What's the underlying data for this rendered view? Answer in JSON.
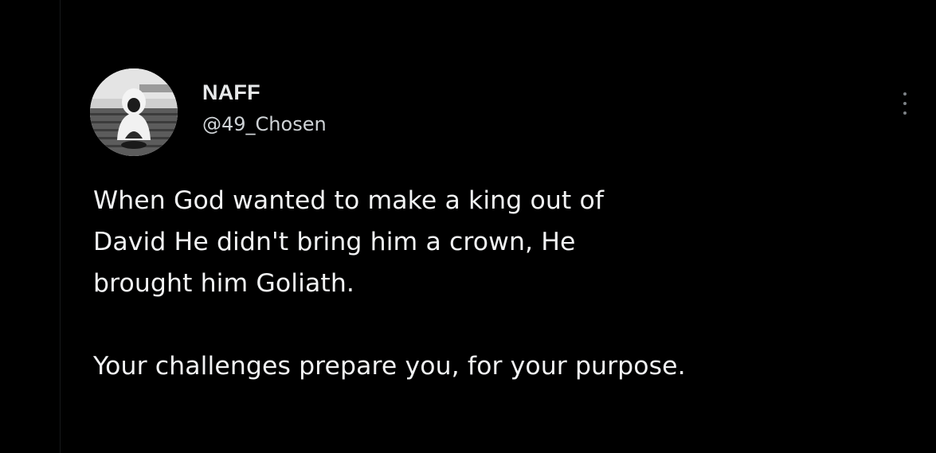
{
  "author": {
    "display_name": "NAFF",
    "handle": "@49_Chosen",
    "avatar_icon": "person-hoodie-photo"
  },
  "menu": {
    "more_icon": "vertical-ellipsis-icon"
  },
  "tweet": {
    "lines": [
      "When God wanted to make a king out of",
      "David He didn't bring him a crown, He",
      "brought him Goliath.",
      "",
      "Your challenges prepare you, for your purpose."
    ]
  },
  "colors": {
    "background": "#000000",
    "text": "#e7e9ea",
    "handle": "#cfd3d6",
    "icon": "#7c8186"
  }
}
